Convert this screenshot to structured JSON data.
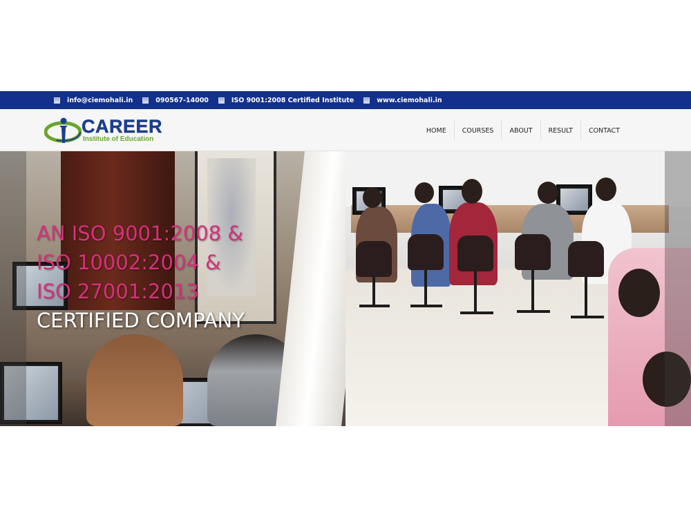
{
  "topbar": {
    "items": [
      {
        "icon": "email-icon",
        "text": "info@ciemohali.in"
      },
      {
        "icon": "phone-icon",
        "text": "090567-14000"
      },
      {
        "icon": "certificate-icon",
        "text": "ISO 9001:2008 Certified Institute"
      },
      {
        "icon": "globe-icon",
        "text": "www.ciemohali.in"
      }
    ],
    "background_color": "#13318c"
  },
  "header": {
    "logo": {
      "title": "CAREER",
      "subtitle": "Institute of Education",
      "title_color": "#1d3f8f",
      "subtitle_color": "#6aa52b"
    },
    "nav": [
      {
        "label": "HOME"
      },
      {
        "label": "COURSES"
      },
      {
        "label": "ABOUT"
      },
      {
        "label": "RESULT"
      },
      {
        "label": "CONTACT"
      }
    ]
  },
  "hero": {
    "lines": [
      "AN ISO 9001:2008 &",
      "ISO 10002:2004 &",
      "ISO 27001:2013",
      "CERTIFIED COMPANY"
    ],
    "accent_color": "#d6307a"
  }
}
